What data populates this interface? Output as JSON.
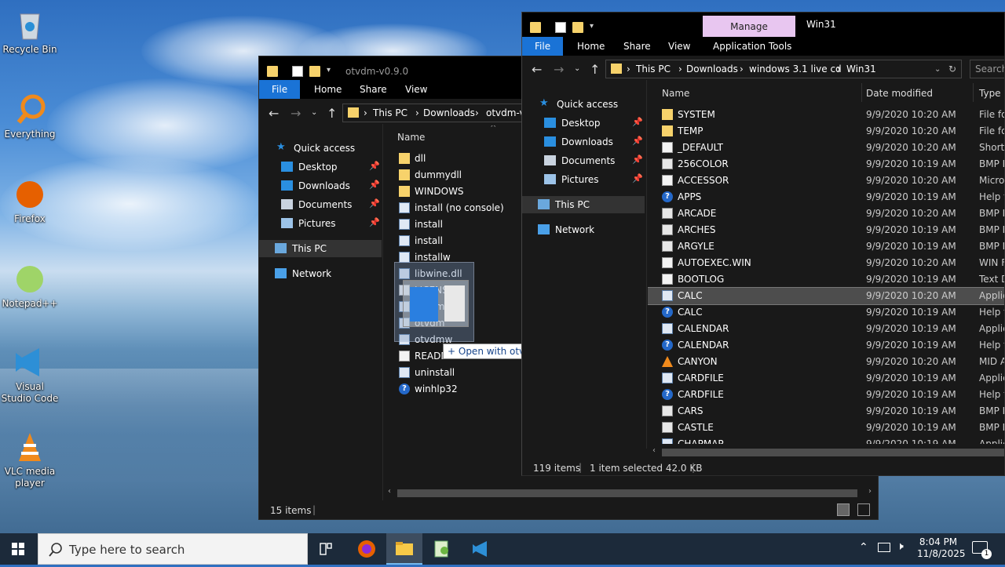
{
  "desktop": {
    "icons": [
      {
        "label": "Recycle Bin",
        "icon": "recycle-bin-icon"
      },
      {
        "label": "Everything",
        "icon": "everything-search-icon"
      },
      {
        "label": "Firefox",
        "icon": "firefox-icon"
      },
      {
        "label": "Notepad++",
        "icon": "notepad-plus-plus-icon"
      },
      {
        "label": "Visual Studio Code",
        "icon": "vscode-icon"
      },
      {
        "label": "VLC media player",
        "icon": "vlc-icon"
      }
    ]
  },
  "win_left": {
    "title": "otvdm-v0.9.0",
    "ribbon": {
      "file": "File",
      "home": "Home",
      "share": "Share",
      "view": "View"
    },
    "breadcrumb": [
      "This PC",
      "Downloads",
      "otvdm-v"
    ],
    "column_name": "Name",
    "nav": [
      {
        "label": "Quick access",
        "icon": "star-icon"
      },
      {
        "label": "Desktop",
        "icon": "desktop-icon",
        "pinned": true
      },
      {
        "label": "Downloads",
        "icon": "download-icon",
        "pinned": true
      },
      {
        "label": "Documents",
        "icon": "documents-icon",
        "pinned": true
      },
      {
        "label": "Pictures",
        "icon": "pictures-icon",
        "pinned": true
      },
      {
        "label": "This PC",
        "icon": "computer-icon",
        "selected": true
      },
      {
        "label": "Network",
        "icon": "network-icon"
      }
    ],
    "files": [
      {
        "name": "dll",
        "icon": "folder-icon"
      },
      {
        "name": "dummydll",
        "icon": "folder-icon"
      },
      {
        "name": "WINDOWS",
        "icon": "folder-icon"
      },
      {
        "name": "install (no console)",
        "icon": "script-icon"
      },
      {
        "name": "install",
        "icon": "script-icon"
      },
      {
        "name": "install",
        "icon": "script-icon"
      },
      {
        "name": "installw",
        "icon": "script-icon"
      },
      {
        "name": "libwine.dll",
        "icon": "dll-icon"
      },
      {
        "name": "LICENSE",
        "icon": "document-icon"
      },
      {
        "name": "otvdm",
        "icon": "app-icon"
      },
      {
        "name": "otvdm",
        "icon": "app-icon"
      },
      {
        "name": "otvdmw",
        "icon": "app-icon"
      },
      {
        "name": "README",
        "icon": "document-icon"
      },
      {
        "name": "uninstall",
        "icon": "script-icon"
      },
      {
        "name": "winhlp32",
        "icon": "help-icon"
      }
    ],
    "status": "15 items",
    "drag_tooltip": "+ Open with otvdmw"
  },
  "win_right": {
    "title": "Win31",
    "manage_tab": "Manage",
    "ribbon": {
      "file": "File",
      "home": "Home",
      "share": "Share",
      "view": "View",
      "app_tools": "Application Tools"
    },
    "breadcrumb": [
      "This PC",
      "Downloads",
      "windows 3.1 live cd",
      "Win31"
    ],
    "search_placeholder": "Search",
    "columns": {
      "name": "Name",
      "date": "Date modified",
      "type": "Type"
    },
    "nav": [
      {
        "label": "Quick access",
        "icon": "star-icon"
      },
      {
        "label": "Desktop",
        "icon": "desktop-icon",
        "pinned": true
      },
      {
        "label": "Downloads",
        "icon": "download-icon",
        "pinned": true
      },
      {
        "label": "Documents",
        "icon": "documents-icon",
        "pinned": true
      },
      {
        "label": "Pictures",
        "icon": "pictures-icon",
        "pinned": true
      },
      {
        "label": "This PC",
        "icon": "computer-icon",
        "selected": true
      },
      {
        "label": "Network",
        "icon": "network-icon"
      }
    ],
    "files": [
      {
        "name": "SYSTEM",
        "date": "9/9/2020 10:20 AM",
        "type": "File fo",
        "icon": "folder-icon"
      },
      {
        "name": "TEMP",
        "date": "9/9/2020 10:20 AM",
        "type": "File fo",
        "icon": "folder-icon"
      },
      {
        "name": "_DEFAULT",
        "date": "9/9/2020 10:20 AM",
        "type": "Shorto",
        "icon": "shortcut-icon"
      },
      {
        "name": "256COLOR",
        "date": "9/9/2020 10:19 AM",
        "type": "BMP F",
        "icon": "bmp-icon"
      },
      {
        "name": "ACCESSOR",
        "date": "9/9/2020 10:20 AM",
        "type": "Micros",
        "icon": "document-icon"
      },
      {
        "name": "APPS",
        "date": "9/9/2020 10:19 AM",
        "type": "Help fi",
        "icon": "help-icon"
      },
      {
        "name": "ARCADE",
        "date": "9/9/2020 10:20 AM",
        "type": "BMP F",
        "icon": "bmp-icon"
      },
      {
        "name": "ARCHES",
        "date": "9/9/2020 10:19 AM",
        "type": "BMP F",
        "icon": "bmp-icon"
      },
      {
        "name": "ARGYLE",
        "date": "9/9/2020 10:19 AM",
        "type": "BMP F",
        "icon": "bmp-icon"
      },
      {
        "name": "AUTOEXEC.WIN",
        "date": "9/9/2020 10:20 AM",
        "type": "WIN F",
        "icon": "document-icon"
      },
      {
        "name": "BOOTLOG",
        "date": "9/9/2020 10:19 AM",
        "type": "Text D",
        "icon": "document-icon"
      },
      {
        "name": "CALC",
        "date": "9/9/2020 10:20 AM",
        "type": "Applic",
        "icon": "app-icon",
        "selected": true
      },
      {
        "name": "CALC",
        "date": "9/9/2020 10:19 AM",
        "type": "Help fi",
        "icon": "help-icon"
      },
      {
        "name": "CALENDAR",
        "date": "9/9/2020 10:19 AM",
        "type": "Applic",
        "icon": "app-icon"
      },
      {
        "name": "CALENDAR",
        "date": "9/9/2020 10:19 AM",
        "type": "Help fi",
        "icon": "help-icon"
      },
      {
        "name": "CANYON",
        "date": "9/9/2020 10:20 AM",
        "type": "MID A",
        "icon": "vlc-cone-icon"
      },
      {
        "name": "CARDFILE",
        "date": "9/9/2020 10:19 AM",
        "type": "Applic",
        "icon": "app-icon"
      },
      {
        "name": "CARDFILE",
        "date": "9/9/2020 10:19 AM",
        "type": "Help fi",
        "icon": "help-icon"
      },
      {
        "name": "CARS",
        "date": "9/9/2020 10:19 AM",
        "type": "BMP F",
        "icon": "bmp-icon"
      },
      {
        "name": "CASTLE",
        "date": "9/9/2020 10:19 AM",
        "type": "BMP F",
        "icon": "bmp-icon"
      },
      {
        "name": "CHAPMAP",
        "date": "9/9/2020 10:19 AM",
        "type": "Applic",
        "icon": "app-icon"
      }
    ],
    "status": {
      "count": "119 items",
      "selected": "1 item selected  42.0 KB"
    }
  },
  "taskbar": {
    "search_placeholder": "Type here to search",
    "time": "8:04 PM",
    "date": "11/8/2025",
    "notification_count": "1"
  }
}
